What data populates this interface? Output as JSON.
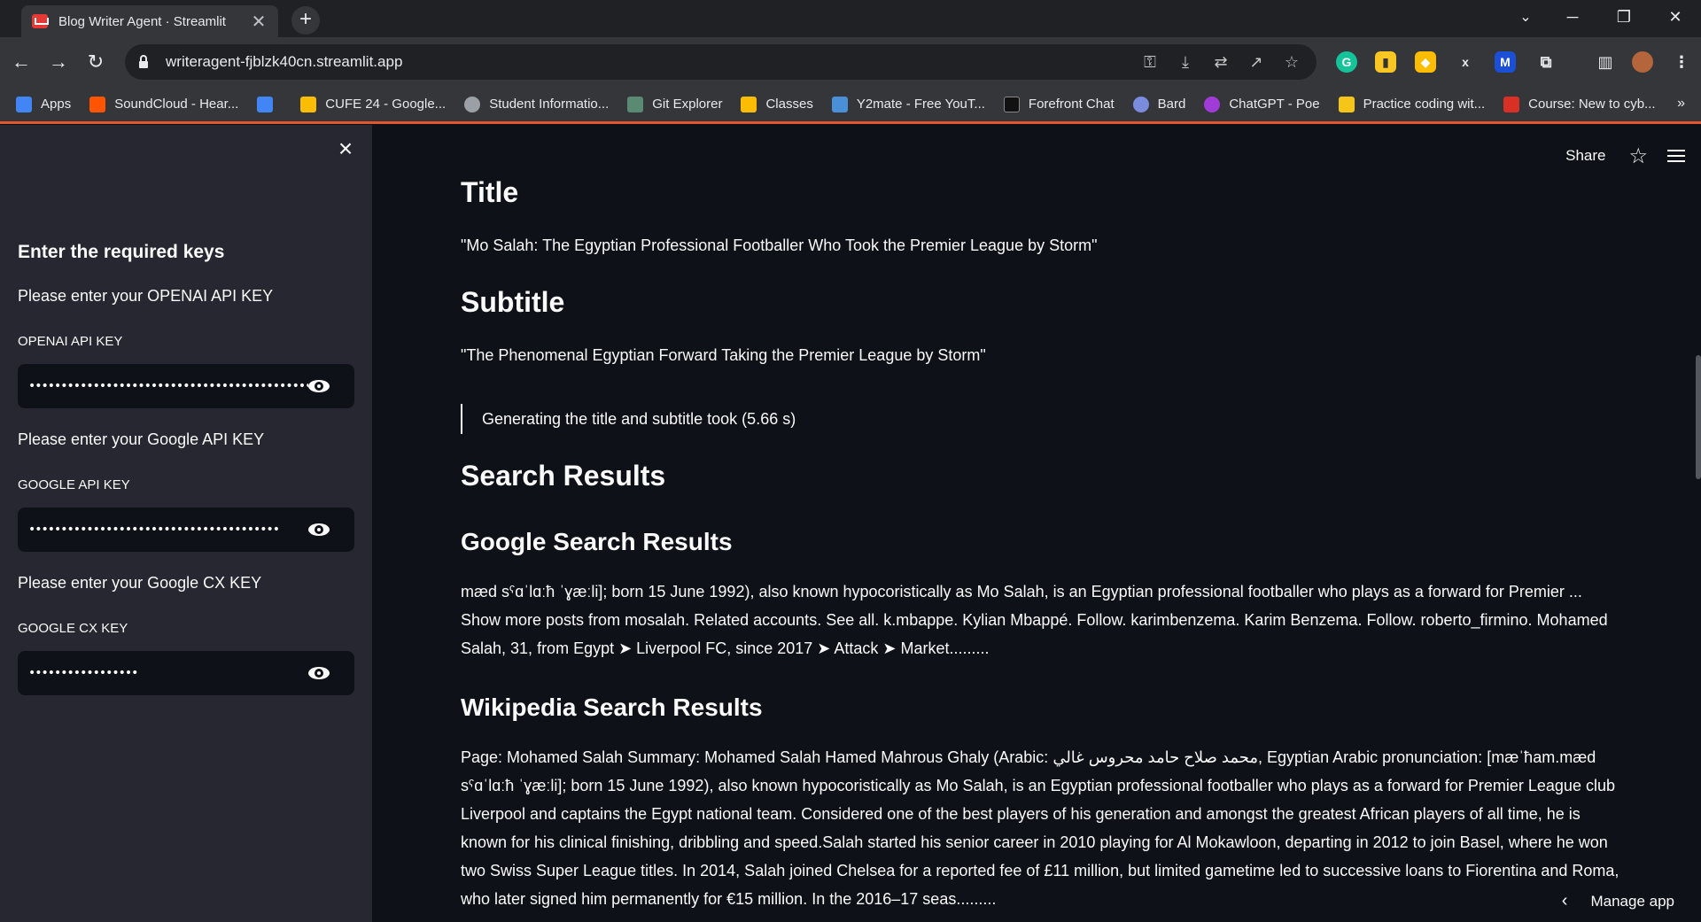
{
  "browser": {
    "tab_title": "Blog Writer Agent · Streamlit",
    "tab_close": "✕",
    "new_tab": "+",
    "url": "writeragent-fjblzk40cn.streamlit.app",
    "bookmarks": [
      {
        "label": "Apps",
        "color": "#4285f4"
      },
      {
        "label": "SoundCloud - Hear...",
        "color": "#ff5500"
      },
      {
        "label": "",
        "color": "#4285f4"
      },
      {
        "label": "CUFE 24 - Google...",
        "color": "#fbbc04"
      },
      {
        "label": "Student Informatio...",
        "color": "#9aa0a6"
      },
      {
        "label": "Git Explorer",
        "color": "#5b8a72"
      },
      {
        "label": "Classes",
        "color": "#fbbc04"
      },
      {
        "label": "Y2mate - Free YouT...",
        "color": "#4a90d9"
      },
      {
        "label": "Forefront Chat",
        "color": "#111111"
      },
      {
        "label": "Bard",
        "color": "#7b8cde"
      },
      {
        "label": "ChatGPT - Poe",
        "color": "#a03bd8"
      },
      {
        "label": "Practice coding wit...",
        "color": "#f5c518"
      },
      {
        "label": "Course: New to cyb...",
        "color": "#d93025"
      }
    ],
    "bookmarks_more": "»"
  },
  "sidebar": {
    "heading": "Enter the required keys",
    "openai": {
      "prompt": "Please enter your OPENAI API KEY",
      "label": "OPENAI API KEY",
      "value": "•••••••••••••••••••••••••••••••••••••••••••••••••••"
    },
    "google": {
      "prompt": "Please enter your Google API KEY",
      "label": "GOOGLE API KEY",
      "value": "•••••••••••••••••••••••••••••••••••••••"
    },
    "cx": {
      "prompt": "Please enter your Google CX KEY",
      "label": "GOOGLE CX KEY",
      "value": "•••••••••••••••••"
    }
  },
  "header": {
    "share": "Share"
  },
  "main": {
    "title_heading": "Title",
    "title_text": "\"Mo Salah: The Egyptian Professional Footballer Who Took the Premier League by Storm\"",
    "subtitle_heading": "Subtitle",
    "subtitle_text": "\"The Phenomenal Egyptian Forward Taking the Premier League by Storm\"",
    "timing": "Generating the title and subtitle took (5.66 s)",
    "search_heading": "Search Results",
    "google_heading": "Google Search Results",
    "google_text": "mæd sˤɑˈlɑːħ ˈɣæːli]; born 15 June 1992), also known hypocoristically as Mo Salah, is an Egyptian professional footballer who plays as a forward for Premier ... Show more posts from mosalah. Related accounts. See all. k.mbappe. Kylian Mbappé. Follow. karimbenzema. Karim Benzema. Follow. roberto_firmino. Mohamed Salah, 31, from Egypt ➤ Liverpool FC, since 2017 ➤ Attack ➤ Market.........",
    "wiki_heading": "Wikipedia Search Results",
    "wiki_text": "Page: Mohamed Salah Summary: Mohamed Salah Hamed Mahrous Ghaly (Arabic: محمد صلاح حامد محروس غالي, Egyptian Arabic pronunciation: [mæˈħam.mæd sˤɑˈlɑːħ ˈɣæːli]; born 15 June 1992), also known hypocoristically as Mo Salah, is an Egyptian professional footballer who plays as a forward for Premier League club Liverpool and captains the Egypt national team. Considered one of the best players of his generation and amongst the greatest African players of all time, he is known for his clinical finishing, dribbling and speed.Salah started his senior career in 2010 playing for Al Mokawloon, departing in 2012 to join Basel, where he won two Swiss Super League titles. In 2014, Salah joined Chelsea for a reported fee of £11 million, but limited gametime led to successive loans to Fiorentina and Roma, who later signed him permanently for €15 million. In the 2016–17 seas........."
  },
  "footer": {
    "manage_app": "Manage app"
  }
}
